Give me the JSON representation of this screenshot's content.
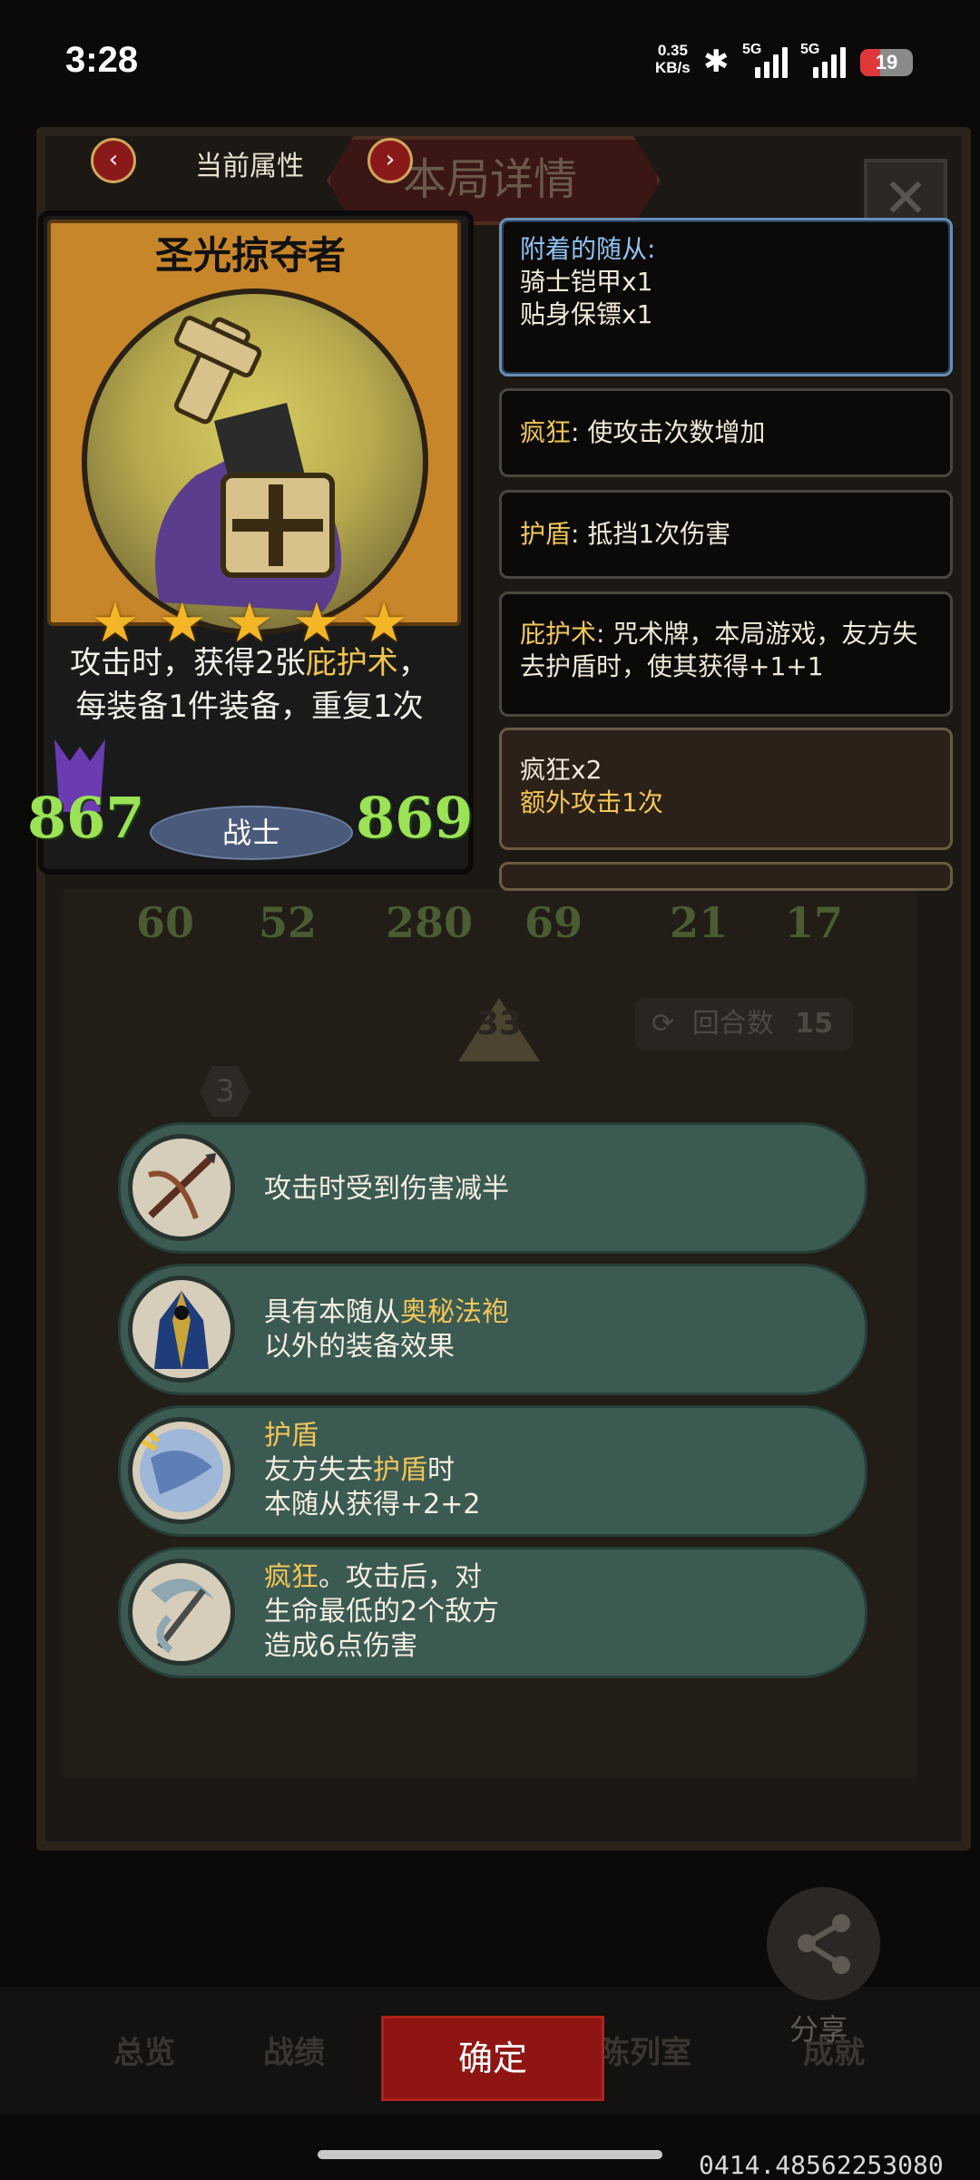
{
  "status_bar": {
    "time": "3:28",
    "net_speed_value": "0.35",
    "net_speed_unit": "KB/s",
    "sim1": "5G",
    "sim2": "5G",
    "battery": "19"
  },
  "header": {
    "title": "本局详情",
    "current_attr_label": "当前属性",
    "close_symbol": "✕"
  },
  "card": {
    "name": "圣光掠夺者",
    "stars": 5,
    "desc_part1": "攻击时，获得2张",
    "desc_keyword": "庇护术",
    "desc_part2": "，每装备1件装备，重复1次",
    "attack": "867",
    "health": "869",
    "class": "战士"
  },
  "panels": [
    {
      "title": "附着的随从:",
      "lines": [
        "骑士铠甲x1",
        "贴身保镖x1"
      ]
    },
    {
      "keyword": "疯狂",
      "text": ": 使攻击次数增加"
    },
    {
      "keyword": "护盾",
      "text": ": 抵挡1次伤害"
    },
    {
      "keyword": "庇护术",
      "text": ": 咒术牌，本局游戏，友方失去护盾时，使其获得+1+1"
    },
    {
      "title": "疯狂x2",
      "sub": "额外攻击1次"
    }
  ],
  "background": {
    "stats": [
      "60",
      "52",
      "280",
      "69",
      "21",
      "17"
    ],
    "arrow_value": "33",
    "round_label": "回合数",
    "round_value": "15",
    "hex_value": "3"
  },
  "abilities": [
    {
      "icon": "crossbow-icon",
      "line1": "攻击时受到伤害减半"
    },
    {
      "icon": "mage-robe-icon",
      "line1_pre": "具有本随从",
      "line1_kw": "奥秘法袍",
      "line2": "以外的装备效果"
    },
    {
      "icon": "shield-orb-icon",
      "line1_kw": "护盾",
      "line2_pre": "友方失去",
      "line2_kw": "护盾",
      "line2_post": "时",
      "line3": "本随从获得+2+2"
    },
    {
      "icon": "scythe-icon",
      "line1_kw": "疯狂",
      "line1_post": "。攻击后，对",
      "line2": "生命最低的2个敌方",
      "line3": "造成6点伤害"
    }
  ],
  "bottom_nav": {
    "items": [
      "总览",
      "战绩",
      "陈列室",
      "成就"
    ],
    "share": "分享",
    "confirm": "确定"
  },
  "footer_code": "0414.48562253080"
}
